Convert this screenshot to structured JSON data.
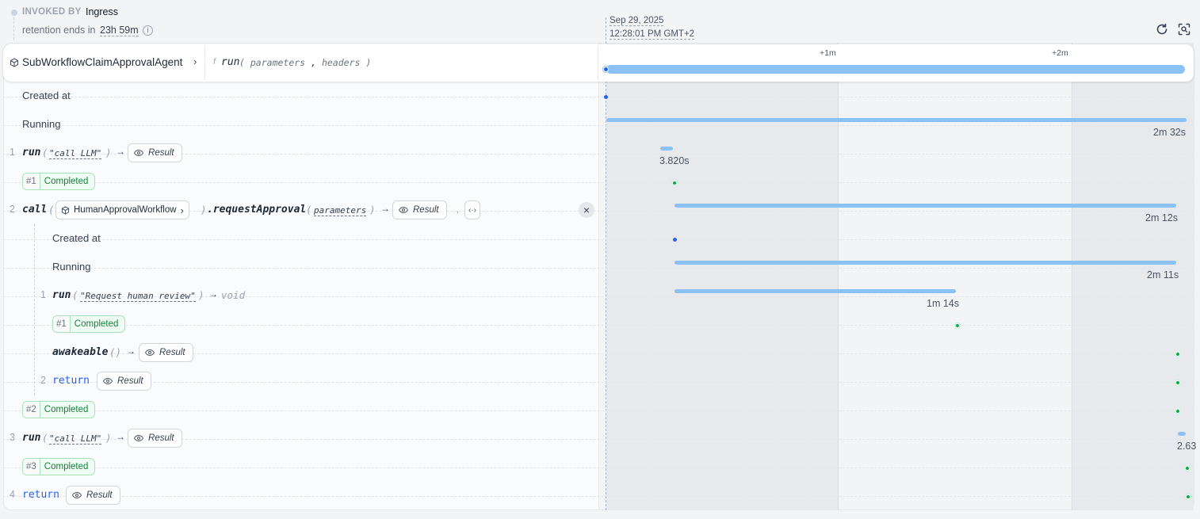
{
  "invocation": {
    "invoked_by_label": "INVOKED BY",
    "invoked_by_value": "Ingress",
    "retention_prefix": "retention ends in",
    "retention_value": "23h 59m"
  },
  "timeline_header": {
    "date": "Sep 29, 2025",
    "time": "12:28:01 PM GMT+2",
    "ticks": [
      "+1m",
      "+2m"
    ]
  },
  "target": {
    "service": "SubWorkflowClaimApprovalAgent",
    "fn_prefix": "f",
    "handler": "run",
    "open_paren": "(",
    "params": [
      "parameters",
      "headers"
    ],
    "close_paren": ")"
  },
  "rows": {
    "created_at": "Created at",
    "running": "Running",
    "running_duration": "2m 32s",
    "step1": {
      "num": "1",
      "fn": "run",
      "arg": "\"call LLM\"",
      "result": "Result",
      "duration": "3.820s"
    },
    "step1_badge": {
      "num": "#1",
      "status": "Completed"
    },
    "step2": {
      "num": "2",
      "fn": "call",
      "service": "HumanApprovalWorkflow",
      "method": ".requestApproval",
      "arg": "parameters",
      "result": "Result",
      "comma": ",",
      "duration": "2m 12s"
    },
    "nested": {
      "created_at": "Created at",
      "running": "Running",
      "running_duration": "2m 11s",
      "n1": {
        "num": "1",
        "fn": "run",
        "arg": "\"Request human review\"",
        "ret": "void",
        "duration": "1m 14s"
      },
      "n1_badge": {
        "num": "#1",
        "status": "Completed"
      },
      "awake": {
        "fn": "awakeable",
        "parens": "()",
        "result": "Result"
      },
      "n2": {
        "num": "2",
        "fn": "return",
        "result": "Result"
      }
    },
    "step2_badge": {
      "num": "#2",
      "status": "Completed"
    },
    "step3": {
      "num": "3",
      "fn": "run",
      "arg": "\"call LLM\"",
      "result": "Result",
      "duration": "2.63"
    },
    "step3_badge": {
      "num": "#3",
      "status": "Completed"
    },
    "step4": {
      "num": "4",
      "fn": "return",
      "result": "Result"
    }
  },
  "symbols": {
    "arrow": "→",
    "chevron": "›",
    "open": "(",
    "close": ")",
    "close_x": "×",
    "code": "‹·›"
  },
  "colors": {
    "bar": "#8cc1f5",
    "completed": "#15803d",
    "accent": "#2563eb"
  }
}
